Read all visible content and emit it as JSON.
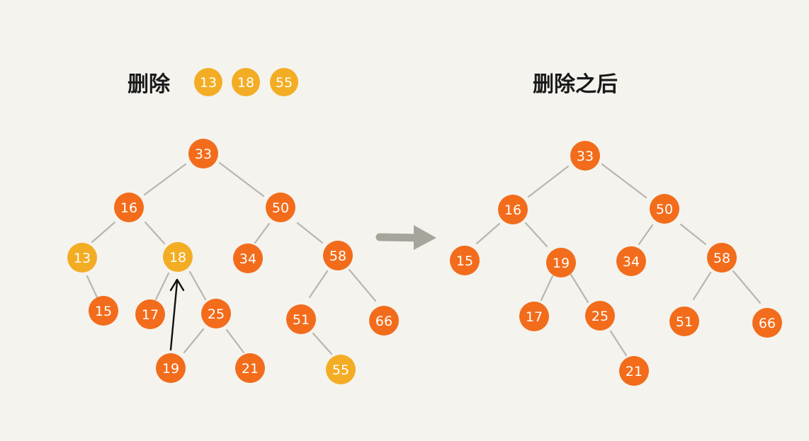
{
  "colors": {
    "background": "#f5f3ee",
    "node_normal": "#f26c1b",
    "node_deleted": "#f3ad24",
    "edge": "#b9b6b0",
    "transition_arrow": "#a6a49b",
    "pointer_arrow": "#111111",
    "label_text": "#ffffff",
    "title_text": "#1a1a1a"
  },
  "left": {
    "title": "删除",
    "deleted_keys": [
      "13",
      "18",
      "55"
    ],
    "nodes": [
      {
        "key": "33",
        "state": "normal"
      },
      {
        "key": "16",
        "state": "normal"
      },
      {
        "key": "50",
        "state": "normal"
      },
      {
        "key": "13",
        "state": "deleted"
      },
      {
        "key": "18",
        "state": "deleted"
      },
      {
        "key": "34",
        "state": "normal"
      },
      {
        "key": "58",
        "state": "normal"
      },
      {
        "key": "15",
        "state": "normal"
      },
      {
        "key": "17",
        "state": "normal"
      },
      {
        "key": "25",
        "state": "normal"
      },
      {
        "key": "51",
        "state": "normal"
      },
      {
        "key": "66",
        "state": "normal"
      },
      {
        "key": "19",
        "state": "normal"
      },
      {
        "key": "21",
        "state": "normal"
      },
      {
        "key": "55",
        "state": "deleted"
      }
    ]
  },
  "right": {
    "title": "删除之后",
    "nodes": [
      {
        "key": "33",
        "state": "normal"
      },
      {
        "key": "16",
        "state": "normal"
      },
      {
        "key": "50",
        "state": "normal"
      },
      {
        "key": "15",
        "state": "normal"
      },
      {
        "key": "19",
        "state": "normal"
      },
      {
        "key": "34",
        "state": "normal"
      },
      {
        "key": "58",
        "state": "normal"
      },
      {
        "key": "17",
        "state": "normal"
      },
      {
        "key": "25",
        "state": "normal"
      },
      {
        "key": "51",
        "state": "normal"
      },
      {
        "key": "66",
        "state": "normal"
      },
      {
        "key": "21",
        "state": "normal"
      }
    ]
  }
}
